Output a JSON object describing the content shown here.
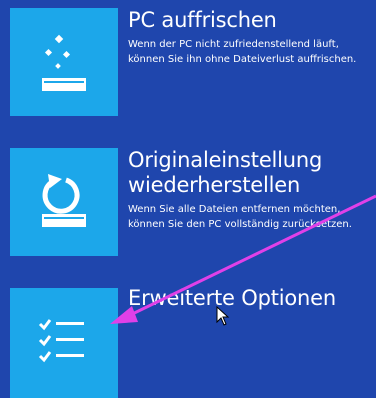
{
  "options": [
    {
      "title": "PC auffrischen",
      "description": "Wenn der PC nicht zufriedenstellend läuft, können Sie ihn ohne Dateiverlust auffrischen.",
      "icon": "refresh-sparkle-icon"
    },
    {
      "title": "Originaleinstellung wiederherstellen",
      "description": "Wenn Sie alle Dateien entfernen möchten, können Sie den PC vollständig zurücksetzen.",
      "icon": "reset-circular-arrow-icon"
    },
    {
      "title": "Erweiterte Optionen",
      "description": "",
      "icon": "checklist-icon"
    }
  ],
  "colors": {
    "background": "#1f46ad",
    "tile": "#1ca7ea",
    "annotation_arrow": "#e040e8"
  }
}
